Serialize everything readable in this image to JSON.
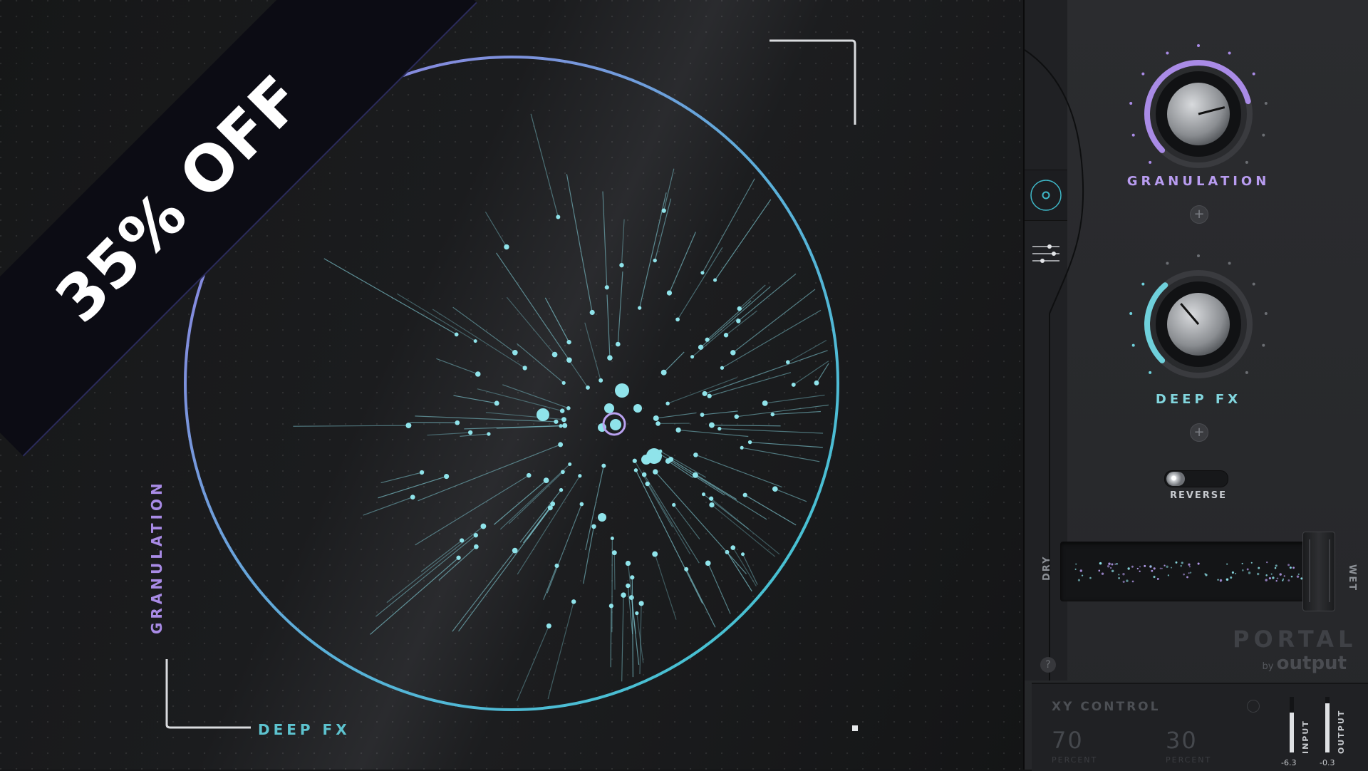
{
  "banner": {
    "text": "35% OFF"
  },
  "xy_display": {
    "y_label": "GRANULATION",
    "x_label": "DEEP FX",
    "colors": {
      "granulation": "#a98be6",
      "deepfx": "#5dc3cf"
    }
  },
  "panel": {
    "granulation": {
      "label": "GRANULATION",
      "level": 0.78
    },
    "deep_fx": {
      "label": "DEEP FX",
      "level": 0.35
    },
    "reverse": {
      "label": "REVERSE",
      "state": "off"
    },
    "mix": {
      "dry_label": "DRY",
      "wet_label": "WET",
      "level": 1.0
    },
    "logo": {
      "name": "PORTAL",
      "by": "by",
      "brand": "output"
    },
    "help_icon": "question-icon",
    "side_tabs": [
      "xy-icon",
      "mixer-icon"
    ]
  },
  "xy_control": {
    "title": "XY CONTROL",
    "value_a": "70",
    "value_b": "30",
    "unit_a": "PERCENT",
    "unit_b": "PERCENT",
    "meters": {
      "input_label": "INPUT",
      "output_label": "OUTPUT",
      "input_value": "-6.3",
      "output_value": "-0.3"
    }
  }
}
